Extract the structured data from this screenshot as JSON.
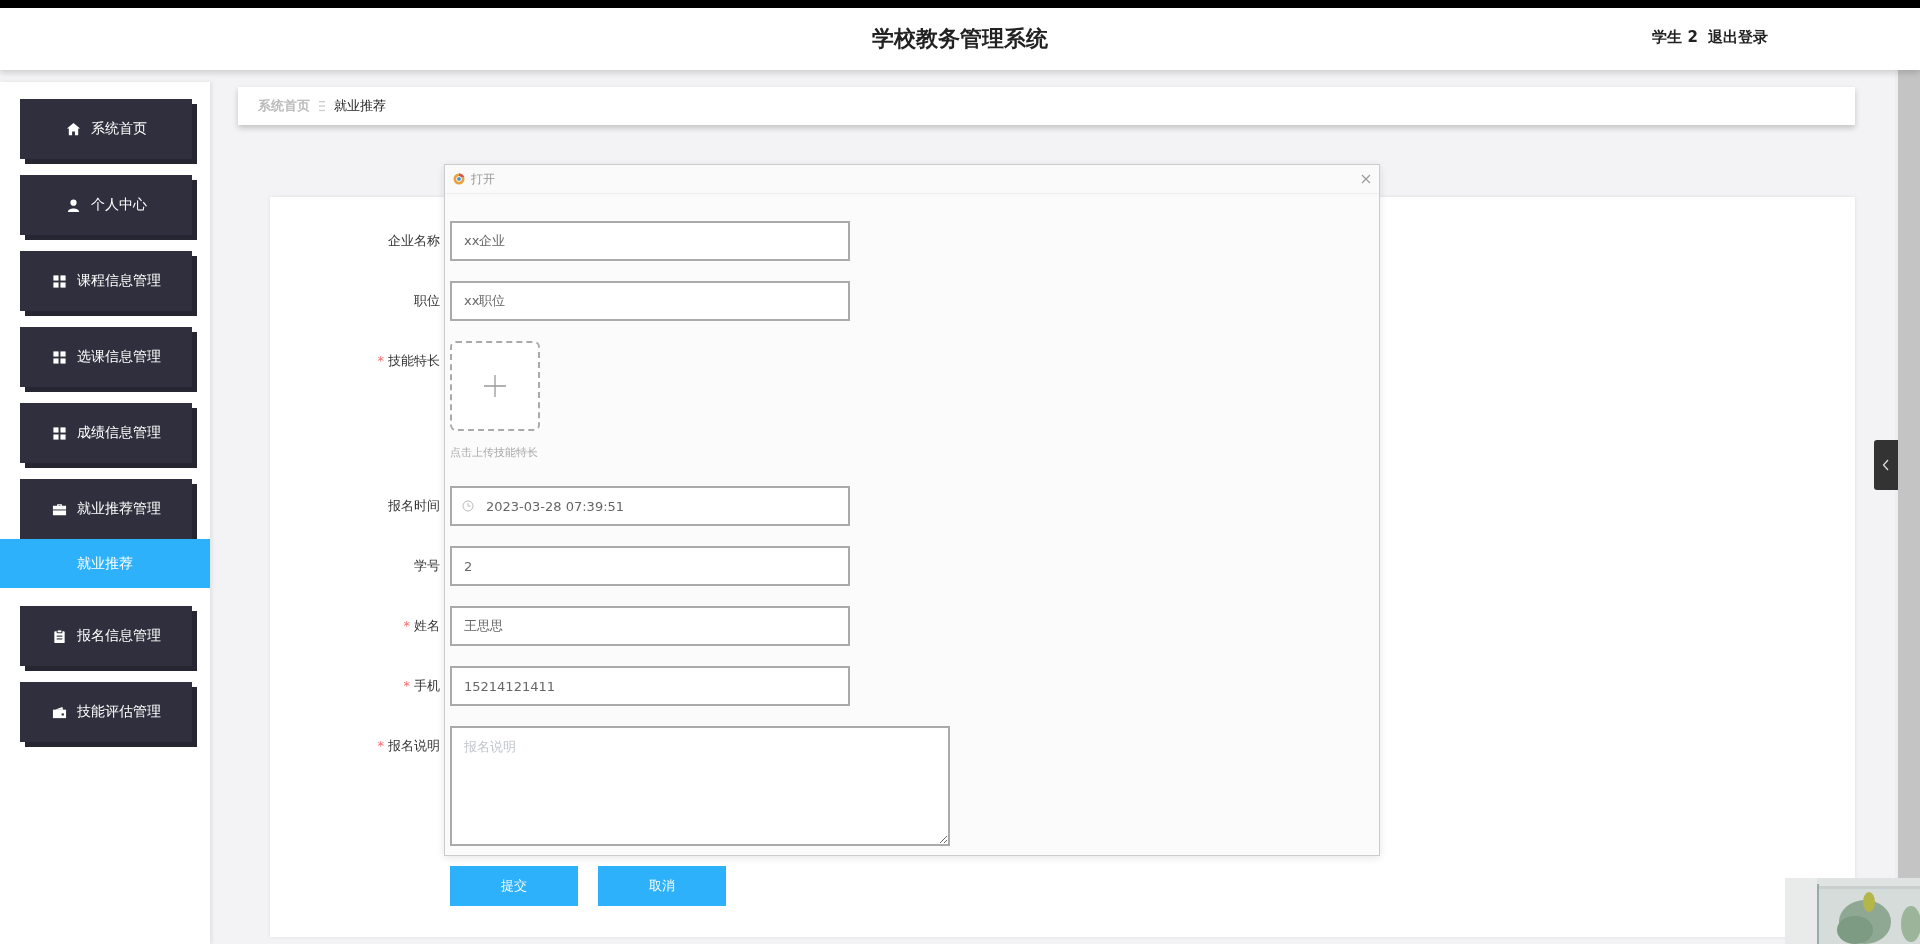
{
  "header": {
    "title": "学校教务管理系统",
    "user": "学生 2",
    "logout": "退出登录"
  },
  "sidebar": {
    "items": [
      {
        "label": "系统首页",
        "kind": "home",
        "selected": false
      },
      {
        "label": "个人中心",
        "kind": "user",
        "selected": false
      },
      {
        "label": "课程信息管理",
        "kind": "grid",
        "selected": false
      },
      {
        "label": "选课信息管理",
        "kind": "grid",
        "selected": false
      },
      {
        "label": "成绩信息管理",
        "kind": "grid",
        "selected": false
      },
      {
        "label": "就业推荐管理",
        "kind": "briefcase",
        "selected": false,
        "expanded": true,
        "children": [
          {
            "label": "就业推荐",
            "selected": true
          }
        ]
      },
      {
        "label": "报名信息管理",
        "kind": "clipboard",
        "selected": false
      },
      {
        "label": "技能评估管理",
        "kind": "wallet",
        "selected": false
      }
    ]
  },
  "breadcrumb": [
    {
      "label": "系统首页",
      "current": false
    },
    {
      "label": "就业推荐",
      "current": true
    }
  ],
  "dialog": {
    "title": "打开"
  },
  "form": {
    "required_mark": "*",
    "fields": [
      {
        "kind": "input",
        "label": "企业名称",
        "required": false,
        "value": "xx企业"
      },
      {
        "kind": "input",
        "label": "职位",
        "required": false,
        "value": "xx职位"
      },
      {
        "kind": "upload",
        "label": "技能特长",
        "required": true,
        "hint": "点击上传技能特长"
      },
      {
        "kind": "date",
        "label": "报名时间",
        "required": false,
        "value": "2023-03-28 07:39:51"
      },
      {
        "kind": "input",
        "label": "学号",
        "required": false,
        "value": "2"
      },
      {
        "kind": "input",
        "label": "姓名",
        "required": true,
        "value": "王思思"
      },
      {
        "kind": "input",
        "label": "手机",
        "required": true,
        "value": "15214121411"
      },
      {
        "kind": "textarea",
        "label": "报名说明",
        "required": true,
        "placeholder": "报名说明"
      }
    ],
    "buttons": [
      "提交",
      "取消"
    ]
  }
}
